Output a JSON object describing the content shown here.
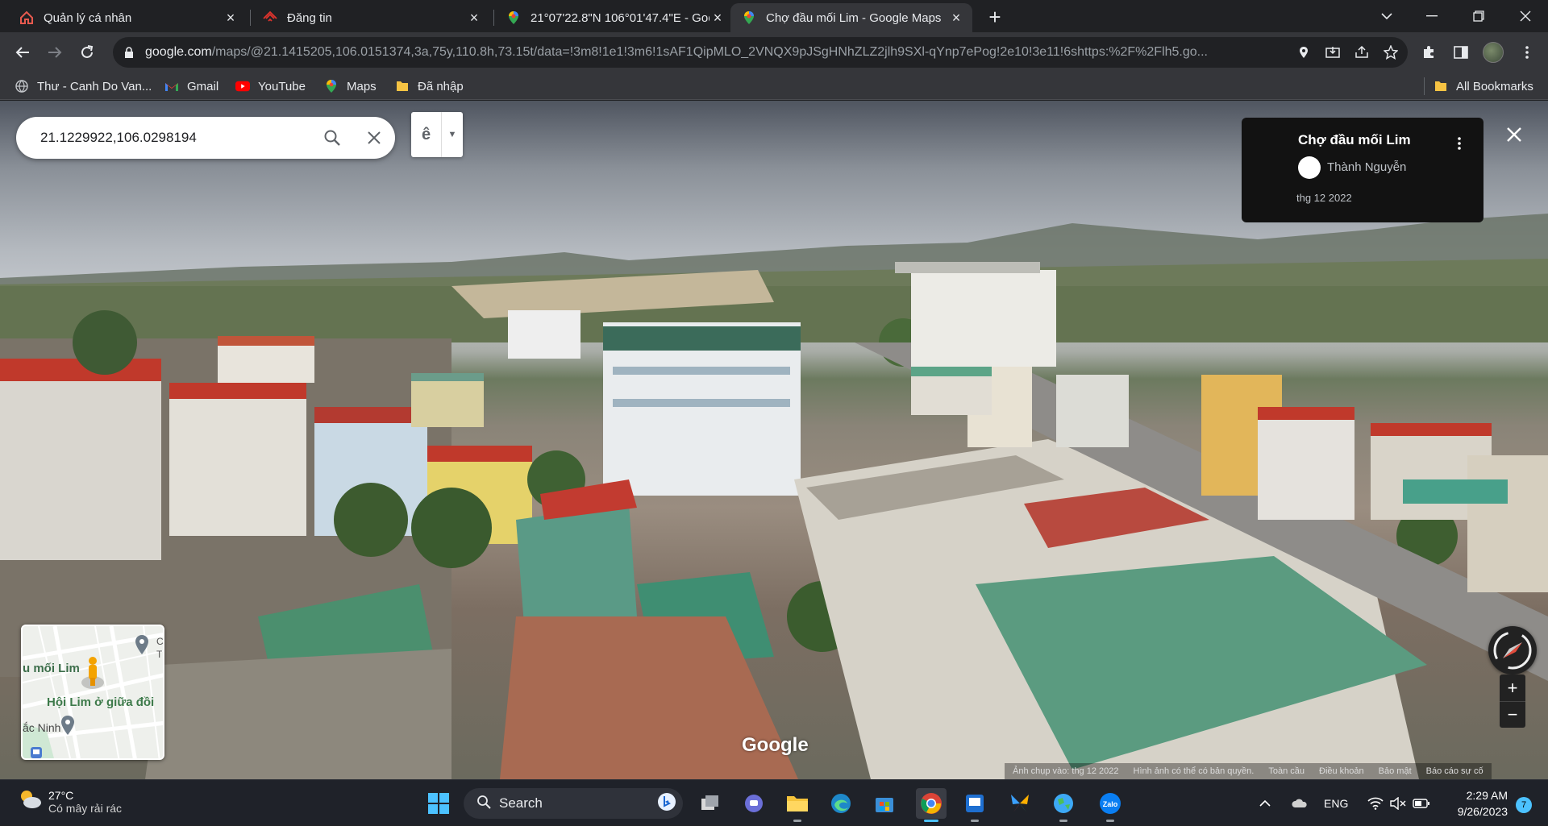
{
  "tabs": [
    {
      "title": "Quản lý cá nhân",
      "icon": "home-icon"
    },
    {
      "title": "Đăng tin",
      "icon": "brand-logo-icon"
    },
    {
      "title": "21°07'22.8\"N 106°01'47.4\"E - Goo",
      "icon": "maps-pin-icon"
    },
    {
      "title": "Chợ đầu mối Lim - Google Maps",
      "icon": "maps-pin-icon",
      "active": true
    }
  ],
  "toolbar": {
    "url_host": "google.com",
    "url_path": "/maps/@21.1415205,106.0151374,3a,75y,110.8h,73.15t/data=!3m8!1e1!3m6!1sAF1QipMLO_2VNQX9pJSgHNhZLZ2jlh9SXl-qYnp7ePog!2e10!3e11!6shttps:%2F%2Flh5.go..."
  },
  "bookmarks": [
    {
      "label": "Thư - Canh Do Van...",
      "icon": "globe-icon"
    },
    {
      "label": "Gmail",
      "icon": "gmail-icon"
    },
    {
      "label": "YouTube",
      "icon": "youtube-icon"
    },
    {
      "label": "Maps",
      "icon": "maps-icon"
    },
    {
      "label": "Đã nhập",
      "icon": "folder-icon"
    }
  ],
  "all_bookmarks_label": "All Bookmarks",
  "streetview": {
    "search_value": "21.1229922,106.0298194",
    "toggle_letter": "ê",
    "place_title": "Chợ đầu mối Lim",
    "author": "Thành Nguyễn",
    "date": "thg 12 2022",
    "google_logo": "Google",
    "minimap": {
      "label_1": "u mối Lim",
      "label_2": "Hội Lim ở giữa đồi",
      "label_3": "ắc Ninh",
      "label_4": "C",
      "label_5": "T"
    },
    "footer": [
      "Ảnh chụp vào: thg 12 2022",
      "Hình ảnh có thể có bản quyền.",
      "Toàn cầu",
      "Điều khoản",
      "Bảo mật",
      "Báo cáo sự cố"
    ],
    "zoom_in": "+",
    "zoom_out": "−"
  },
  "taskbar": {
    "temperature": "27°C",
    "condition": "Có mây rải rác",
    "search_label": "Search",
    "language": "ENG",
    "time": "2:29 AM",
    "date": "9/26/2023",
    "notification_count": "7"
  },
  "colors": {
    "accent": "#4cc2ff",
    "card_bg": "#121212",
    "maps_red": "#ea4335",
    "maps_green": "#34a853",
    "maps_blue": "#4285f4",
    "maps_yellow": "#fbbc04"
  }
}
